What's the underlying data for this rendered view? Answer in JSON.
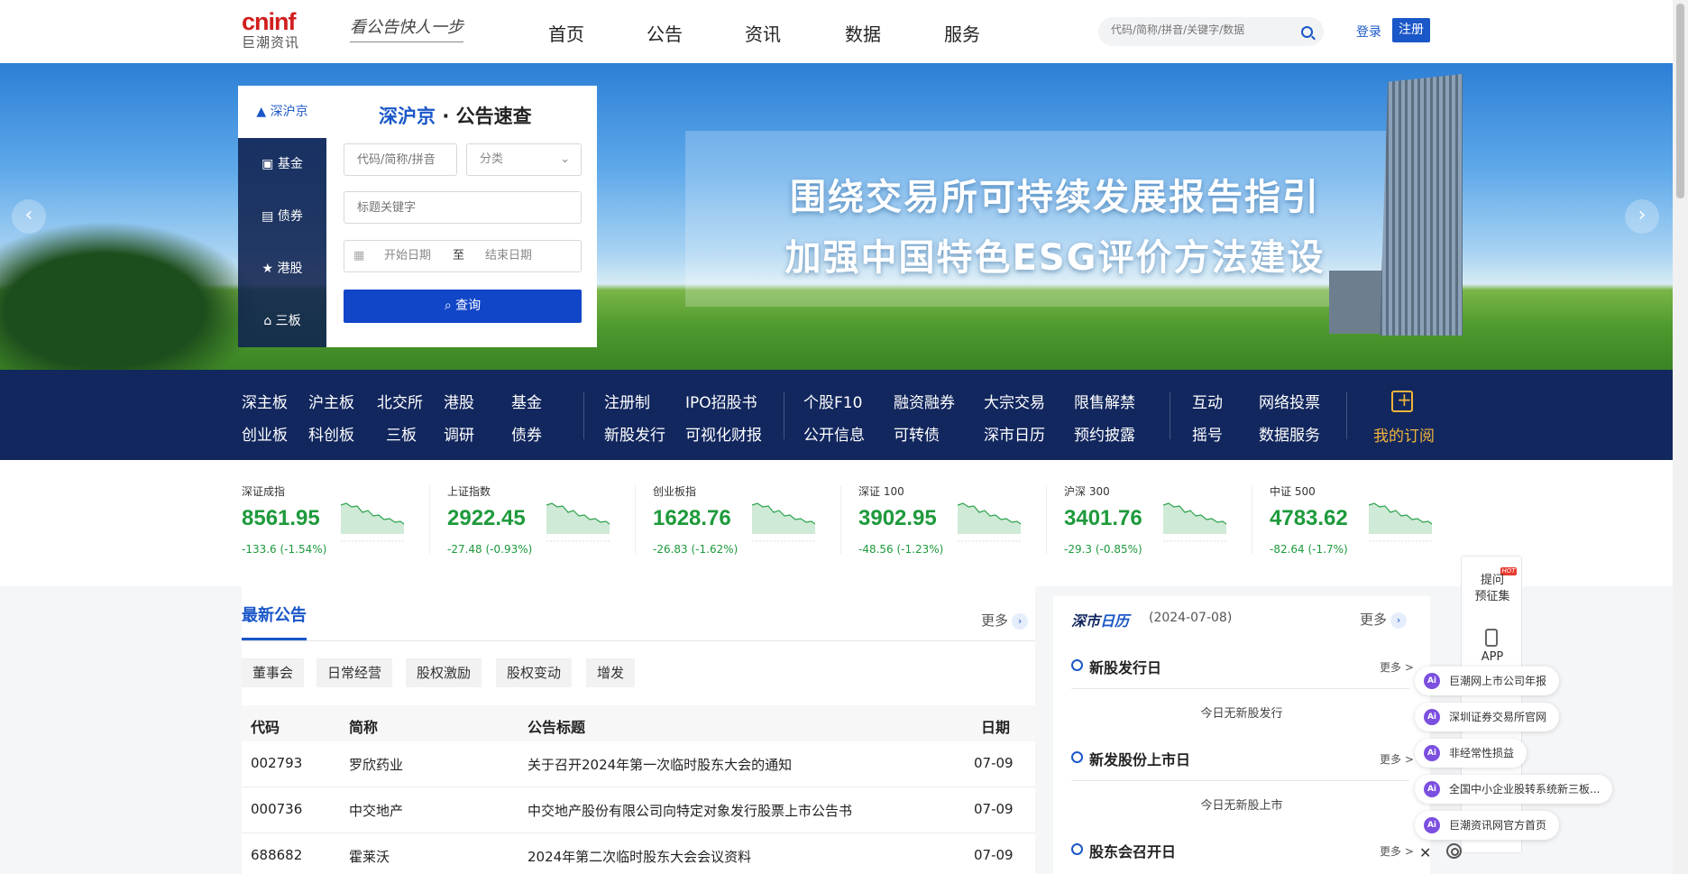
{
  "header": {
    "brand": "cninf",
    "brand_sub": "巨潮资讯",
    "slogan": "看公告快人一步",
    "nav": [
      "首页",
      "公告",
      "资讯",
      "数据",
      "服务"
    ],
    "search_placeholder": "代码/简称/拼音/关键字/数据",
    "login": "登录",
    "register": "注册"
  },
  "banner": {
    "line1": "围绕交易所可持续发展报告指引",
    "line2": "加强中国特色ESG评价方法建设",
    "prev": "‹",
    "next": "›"
  },
  "query": {
    "tabs": [
      {
        "icon": "chart-icon",
        "label": "深沪京"
      },
      {
        "icon": "camera-icon",
        "label": "基金"
      },
      {
        "icon": "ticket-icon",
        "label": "债券"
      },
      {
        "icon": "star-icon",
        "label": "港股"
      },
      {
        "icon": "home-icon",
        "label": "三板"
      }
    ],
    "title_highlight": "深沪京",
    "title_rest": "· 公告速查",
    "code_placeholder": "代码/简称/拼音",
    "category_value": "分类",
    "keyword_placeholder": "标题关键字",
    "start_date": "开始日期",
    "to": "至",
    "end_date": "结束日期",
    "button": "查询"
  },
  "band": {
    "row1": [
      "深主板",
      "沪主板",
      "北交所",
      "港股",
      "基金",
      "注册制",
      "IPO招股书",
      "个股F10",
      "融资融券",
      "大宗交易",
      "限售解禁",
      "互动",
      "网络投票"
    ],
    "row2": [
      "创业板",
      "科创板",
      "三板",
      "调研",
      "债券",
      "新股发行",
      "可视化财报",
      "公开信息",
      "可转债",
      "深市日历",
      "预约披露",
      "摇号",
      "数据服务"
    ],
    "subscribe": "我的订阅"
  },
  "indices": [
    {
      "name": "深证成指",
      "value": "8561.95",
      "change": "-133.6 (-1.54%)"
    },
    {
      "name": "上证指数",
      "value": "2922.45",
      "change": "-27.48 (-0.93%)"
    },
    {
      "name": "创业板指",
      "value": "1628.76",
      "change": "-26.83 (-1.62%)"
    },
    {
      "name": "深证 100",
      "value": "3902.95",
      "change": "-48.56 (-1.23%)"
    },
    {
      "name": "沪深 300",
      "value": "3401.76",
      "change": "-29.3 (-0.85%)"
    },
    {
      "name": "中证 500",
      "value": "4783.62",
      "change": "-82.64 (-1.7%)"
    }
  ],
  "announcements": {
    "title": "最新公告",
    "more": "更多",
    "categories": [
      "董事会",
      "日常经营",
      "股权激励",
      "股权变动",
      "增发"
    ],
    "columns": [
      "代码",
      "简称",
      "公告标题",
      "日期"
    ],
    "rows": [
      {
        "code": "002793",
        "name": "罗欣药业",
        "title": "关于召开2024年第一次临时股东大会的通知",
        "date": "07-09"
      },
      {
        "code": "000736",
        "name": "中交地产",
        "title": "中交地产股份有限公司向特定对象发行股票上市公告书",
        "date": "07-09"
      },
      {
        "code": "688682",
        "name": "霍莱沃",
        "title": "2024年第二次临时股东大会会议资料",
        "date": "07-09"
      }
    ]
  },
  "calendar": {
    "title_a": "深市",
    "title_b": "日历",
    "date": "(2024-07-08)",
    "more": "更多",
    "sections": [
      {
        "title": "新股发行日",
        "more": "更多 >",
        "empty": "今日无新股发行"
      },
      {
        "title": "新发股份上市日",
        "more": "更多 >",
        "empty": "今日无新股上市"
      },
      {
        "title": "股东会召开日",
        "more": "更多 >",
        "empty": ""
      }
    ]
  },
  "float_widget": {
    "hot": "HOT",
    "ask": "提问\n预征集",
    "app": "APP",
    "ai_badge": "Ai",
    "ai_links": [
      "巨潮网上市公司年报",
      "深圳证券交易所官网",
      "非经常性损益",
      "全国中小企业股转系统新三板...",
      "巨潮资讯网官方首页"
    ],
    "close": "✕"
  }
}
